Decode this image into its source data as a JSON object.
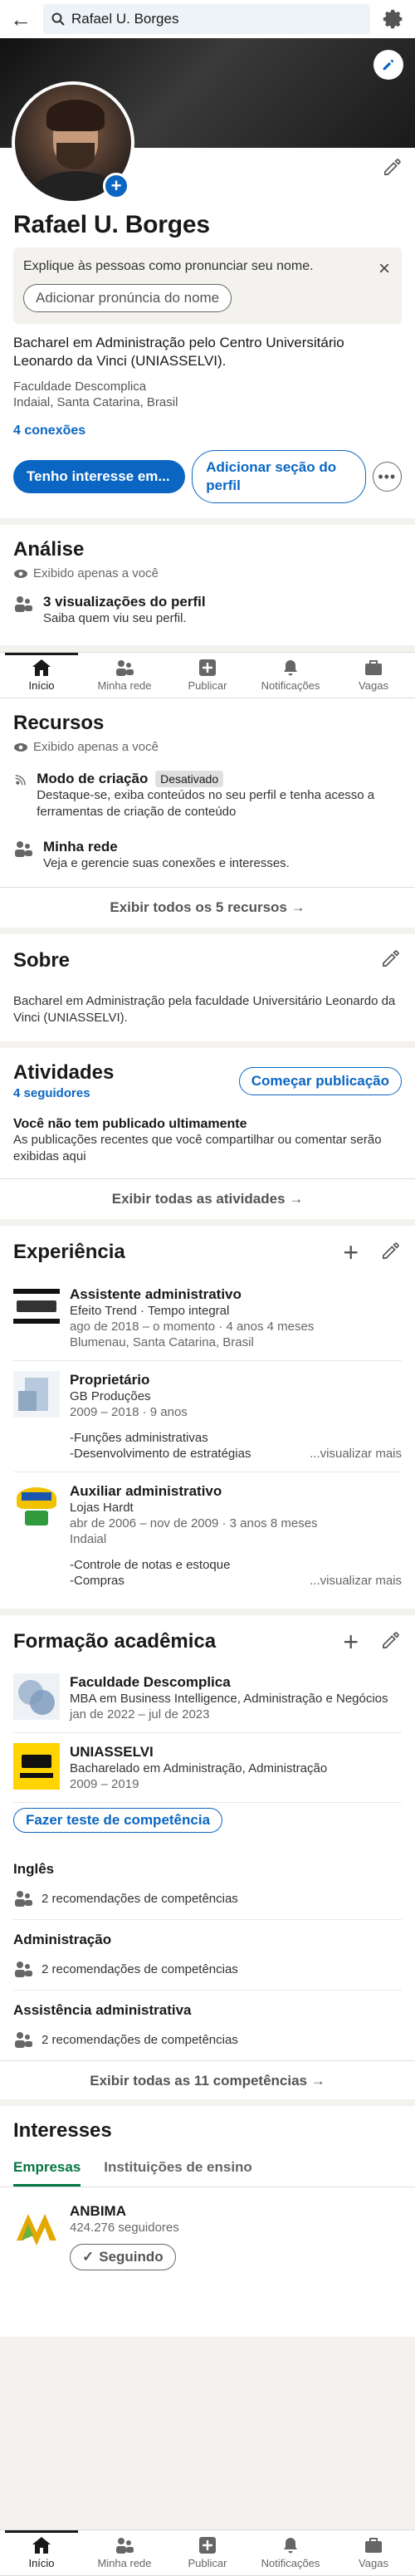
{
  "search": {
    "query": "Rafael U. Borges"
  },
  "profile": {
    "name": "Rafael U. Borges",
    "pronunciation_prompt": "Explique às pessoas como pronunciar seu nome.",
    "pronunciation_button": "Adicionar pronúncia do nome",
    "headline": "Bacharel em Administração pelo Centro Universitário Leonardo da Vinci (UNIASSELVI).",
    "school": "Faculdade Descomplica",
    "location": "Indaial, Santa Catarina, Brasil",
    "connections": "4 conexões",
    "primary_action": "Tenho interesse em...",
    "secondary_action": "Adicionar seção do perfil"
  },
  "analytics": {
    "title": "Análise",
    "private_note": "Exibido apenas a você",
    "item_title": "3 visualizações do perfil",
    "item_sub": "Saiba quem viu seu perfil."
  },
  "nav": {
    "tabs": [
      {
        "label": "Início"
      },
      {
        "label": "Minha rede"
      },
      {
        "label": "Publicar"
      },
      {
        "label": "Notificações"
      },
      {
        "label": "Vagas"
      }
    ]
  },
  "resources": {
    "title": "Recursos",
    "private_note": "Exibido apenas a você",
    "items": [
      {
        "title": "Modo de criação",
        "badge": "Desativado",
        "sub": "Destaque-se, exiba conteúdos no seu perfil e tenha acesso a ferramentas de criação de conteúdo"
      },
      {
        "title": "Minha rede",
        "sub": "Veja e gerencie suas conexões e interesses."
      }
    ],
    "show_all": "Exibir todos os 5 recursos →"
  },
  "about": {
    "title": "Sobre",
    "text": "Bacharel em Administração pela faculdade Universitário Leonardo da Vinci (UNIASSELVI)."
  },
  "activity": {
    "title": "Atividades",
    "followers": "4 seguidores",
    "start_post": "Começar publicação",
    "empty_title": "Você não tem publicado ultimamente",
    "empty_sub": "As publicações recentes que você compartilhar ou comentar serão exibidas aqui",
    "show_all": "Exibir todas as atividades →"
  },
  "experience": {
    "title": "Experiência",
    "items": [
      {
        "title": "Assistente administrativo",
        "company": "Efeito Trend · Tempo integral",
        "dates": "ago de 2018 – o momento · 4 anos 4 meses",
        "place": "Blumenau, Santa Catarina, Brasil",
        "desc1": "",
        "desc2": "",
        "more": ""
      },
      {
        "title": "Proprietário",
        "company": "GB Produções",
        "dates": "2009 – 2018 · 9 anos",
        "place": "",
        "desc1": "-Funções administrativas",
        "desc2": "-Desenvolvimento de estratégias",
        "more": "...visualizar mais"
      },
      {
        "title": "Auxiliar administrativo",
        "company": "Lojas Hardt",
        "dates": "abr de 2006 – nov de 2009 · 3 anos 8 meses",
        "place": "Indaial",
        "desc1": "-Controle de notas e estoque",
        "desc2": "-Compras",
        "more": "...visualizar mais"
      }
    ]
  },
  "education": {
    "title": "Formação acadêmica",
    "items": [
      {
        "school": "Faculdade Descomplica",
        "degree": "MBA em Business Intelligence, Administração e Negócios",
        "dates": "jan de 2022 – jul de 2023"
      },
      {
        "school": "UNIASSELVI",
        "degree": "Bacharelado em Administração, Administração",
        "dates": "2009 – 2019"
      }
    ]
  },
  "skills": {
    "test_button": "Fazer teste de competência",
    "items": [
      {
        "name": "Inglês",
        "recs": "2 recomendações de competências"
      },
      {
        "name": "Administração",
        "recs": "2 recomendações de competências"
      },
      {
        "name": "Assistência administrativa",
        "recs": "2 recomendações de competências"
      }
    ],
    "show_all": "Exibir todas as 11 competências →"
  },
  "interests": {
    "title": "Interesses",
    "tabs": [
      "Empresas",
      "Instituições de ensino"
    ],
    "company": "ANBIMA",
    "followers": "424.276 seguidores",
    "following_button": "Seguindo"
  },
  "colors": {
    "accent": "#0a66c2",
    "green": "#057642"
  }
}
